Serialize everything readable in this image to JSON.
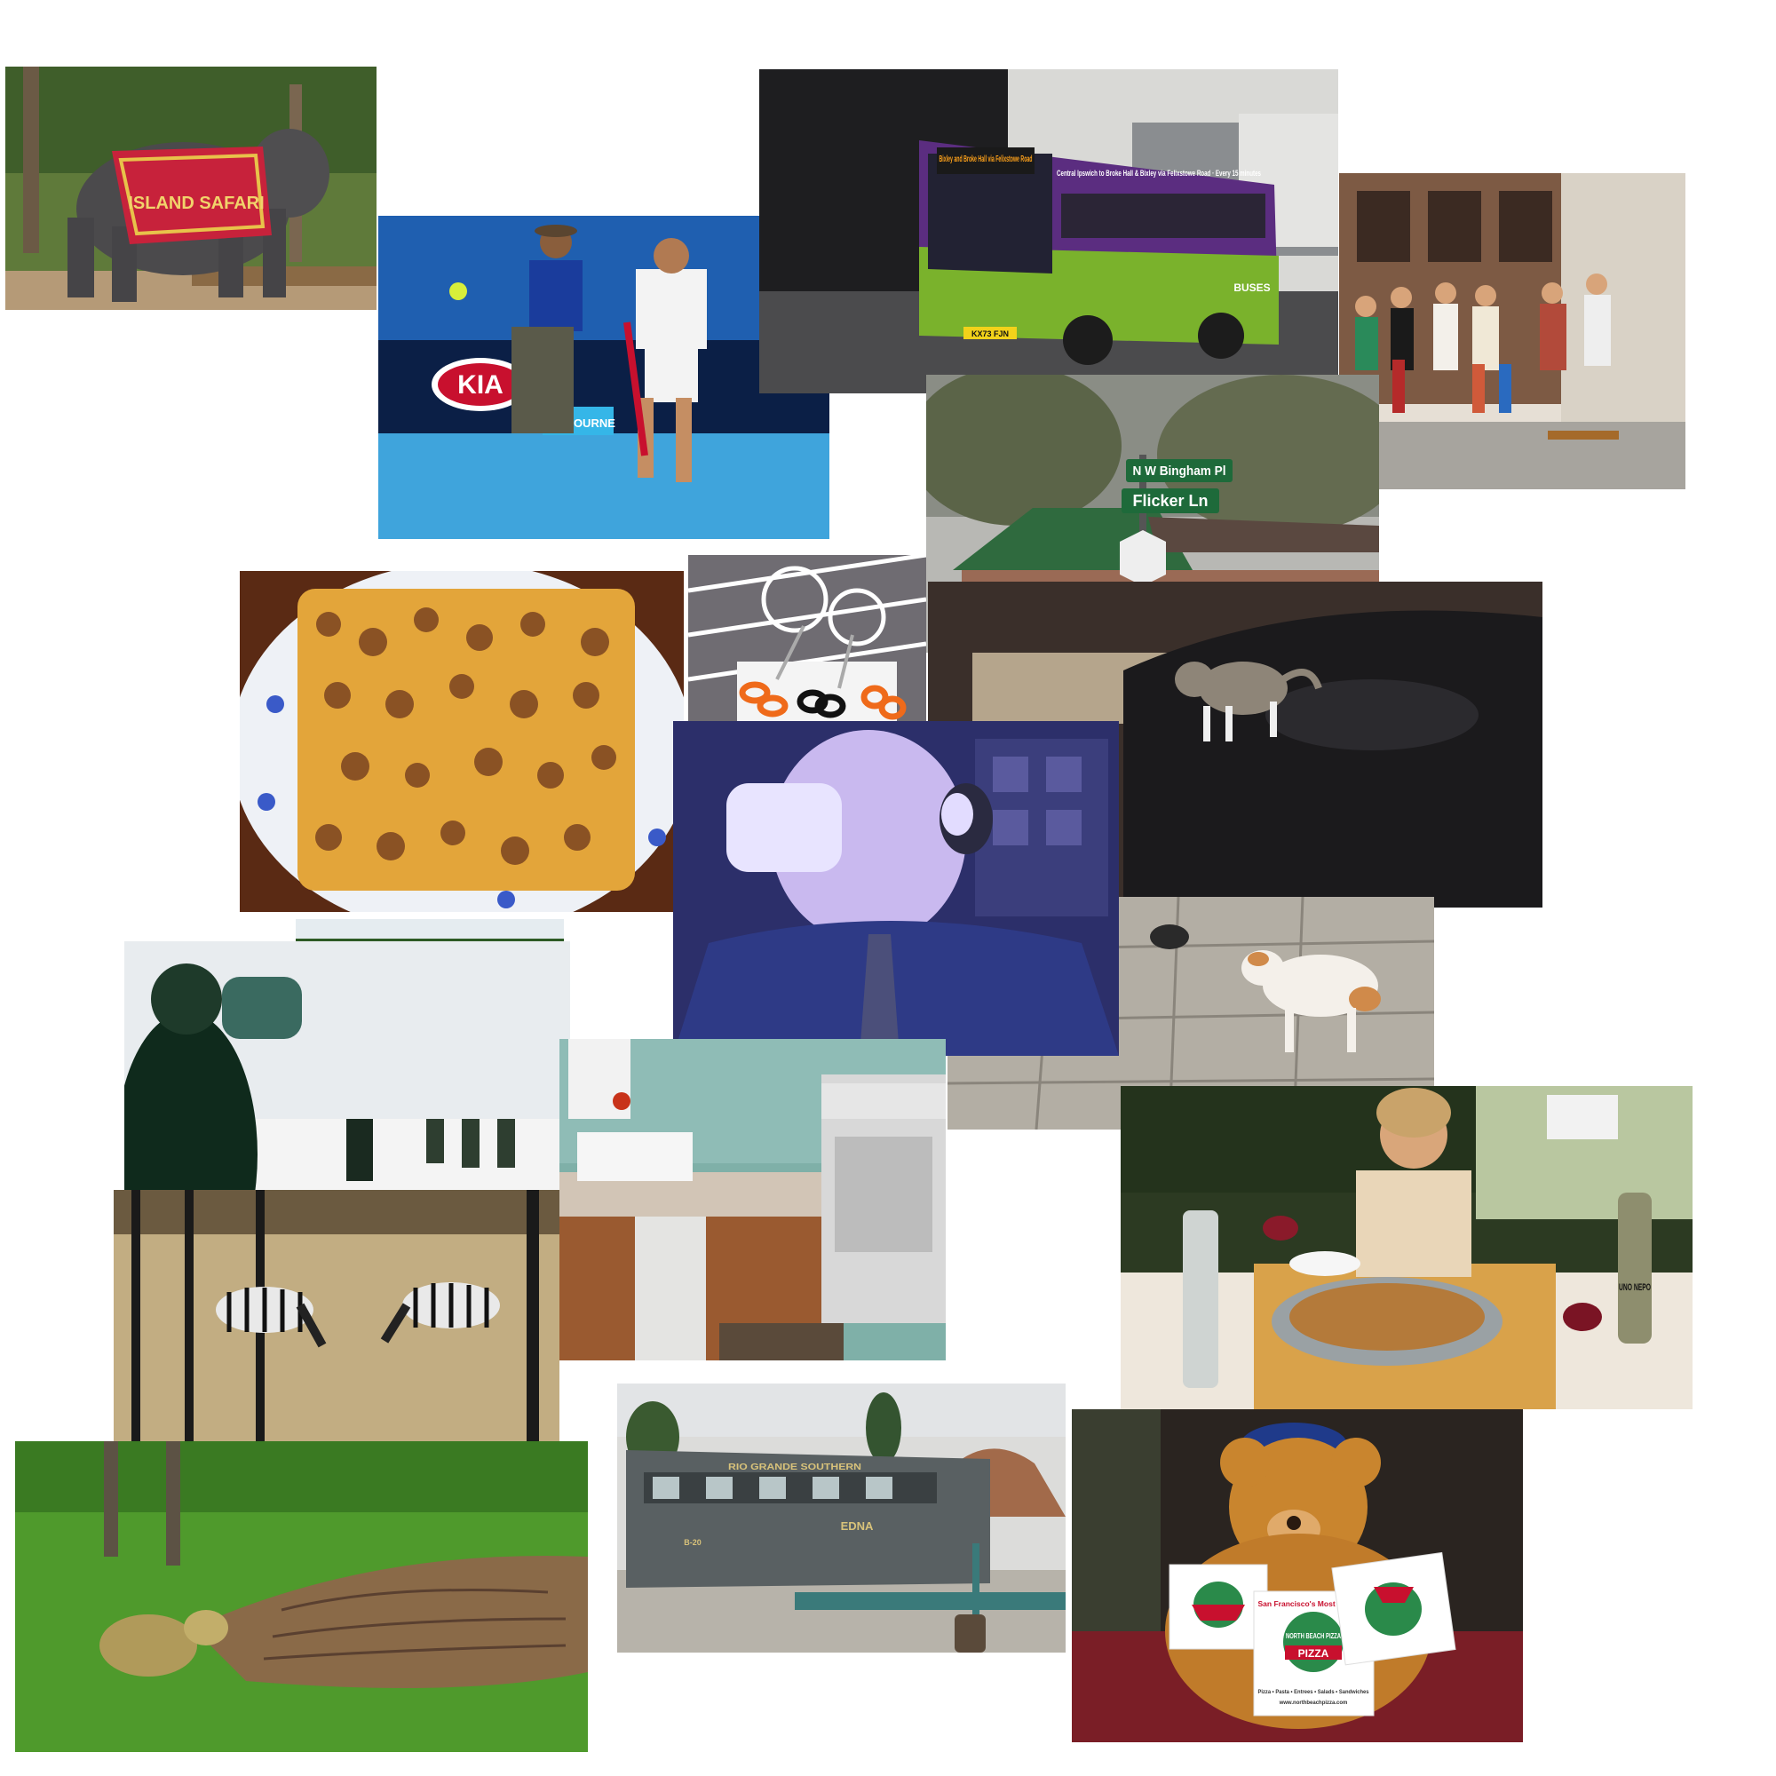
{
  "collage": {
    "photos": [
      {
        "id": "elephant",
        "caption": "ISLAND SAFARI"
      },
      {
        "id": "tennis",
        "sign": "KIA",
        "board": "MELBOURNE"
      },
      {
        "id": "bus",
        "destination": "Bixley and Broke Hall via Felixstowe Road",
        "side": "Central Ipswich to Broke Hall & Bixley via Felixstowe Road · Every 15 minutes",
        "brand": "BUSES",
        "plate": "KX73 FJN"
      },
      {
        "id": "skaters"
      },
      {
        "id": "street-signs",
        "sign1": "N W Bingham Pl",
        "sign2": "Flicker Ln"
      },
      {
        "id": "walnut-cake"
      },
      {
        "id": "scissors"
      },
      {
        "id": "cat-on-car"
      },
      {
        "id": "drinking-man"
      },
      {
        "id": "white-cat"
      },
      {
        "id": "cow"
      },
      {
        "id": "skiers"
      },
      {
        "id": "kitchen"
      },
      {
        "id": "woman-dinner",
        "bottle_label": "UNO NEPO"
      },
      {
        "id": "zebras"
      },
      {
        "id": "goose"
      },
      {
        "id": "train",
        "railroad": "RIO GRANDE SOUTHERN",
        "car_name": "EDNA",
        "car_number": "B-20"
      },
      {
        "id": "teddy-bear",
        "box_brand": "NORTH BEACH PIZZA",
        "box_top": "San Francisco's Most Awarded",
        "box_sub": "PIZZA",
        "box_menu": "Pizza • Pasta • Entrees • Salads • Sandwiches",
        "box_url": "www.northbeachpizza.com"
      }
    ]
  }
}
